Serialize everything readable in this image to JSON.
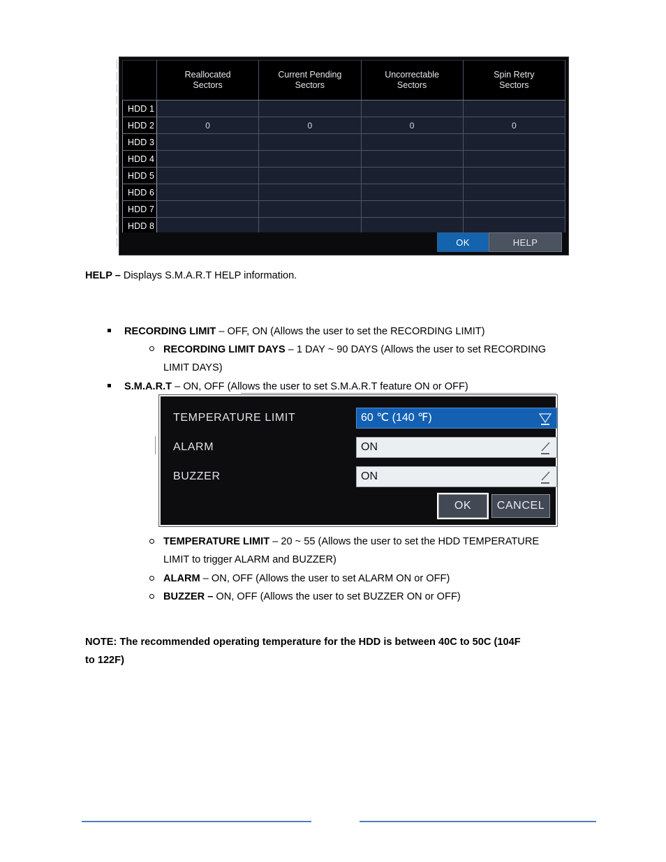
{
  "smart_table_screenshot": {
    "columns": [
      "",
      "Reallocated\nSectors",
      "Current Pending\nSectors",
      "Uncorrectable\nSectors",
      "Spin Retry\nSectors"
    ],
    "column_headers": [
      {
        "line1": "Reallocated",
        "line2": "Sectors"
      },
      {
        "line1": "Current Pending",
        "line2": "Sectors"
      },
      {
        "line1": "Uncorrectable",
        "line2": "Sectors"
      },
      {
        "line1": "Spin Retry",
        "line2": "Sectors"
      }
    ],
    "rows": [
      {
        "label": "HDD 1",
        "values": [
          "",
          "",
          "",
          ""
        ]
      },
      {
        "label": "HDD 2",
        "values": [
          "0",
          "0",
          "0",
          "0"
        ]
      },
      {
        "label": "HDD 3",
        "values": [
          "",
          "",
          "",
          ""
        ]
      },
      {
        "label": "HDD 4",
        "values": [
          "",
          "",
          "",
          ""
        ]
      },
      {
        "label": "HDD 5",
        "values": [
          "",
          "",
          "",
          ""
        ]
      },
      {
        "label": "HDD 6",
        "values": [
          "",
          "",
          "",
          ""
        ]
      },
      {
        "label": "HDD 7",
        "values": [
          "",
          "",
          "",
          ""
        ]
      },
      {
        "label": "HDD 8",
        "values": [
          "",
          "",
          "",
          ""
        ]
      }
    ],
    "buttons": {
      "ok": "OK",
      "help": "HELP"
    },
    "colors": {
      "ok_button": "#1463ad",
      "help_button": "#4c5360",
      "row_bg": "#1b2030",
      "header_bg": "#000000"
    }
  },
  "help_paragraph": {
    "bold": "HELP –",
    "text": " Displays S.M.A.R.T HELP information."
  },
  "settings_list": {
    "item1": {
      "bold": "RECORDING LIMIT",
      "text": " – OFF, ON (Allows the user to set the RECORDING LIMIT)"
    },
    "item1_sub": {
      "bold": "RECORDING LIMIT DAYS",
      "text_line1": " – 1 DAY ~ 90 DAYS (Allows the user to set RECORDING",
      "text_line2": "LIMIT DAYS)"
    },
    "item2": {
      "bold": "S.M.A.R.T",
      "text": " – ON, OFF (Allows the user to set S.M.A.R.T feature ON or OFF)"
    }
  },
  "temperature_dialog_screenshot": {
    "rows": [
      {
        "label": "TEMPERATURE LIMIT",
        "value": "60 ℃ (140 ℉)",
        "selected": true
      },
      {
        "label": "ALARM",
        "value": "ON",
        "selected": false
      },
      {
        "label": "BUZZER",
        "value": "ON",
        "selected": false
      }
    ],
    "buttons": {
      "ok": "OK",
      "cancel": "CANCEL"
    },
    "colors": {
      "selected_field": "#1461b4",
      "plain_field": "#eceff2",
      "dialog_bg": "#0d0d0f"
    }
  },
  "temperature_list": {
    "item1": {
      "bold": "TEMPERATURE LIMIT",
      "text_line1": " – 20 ~ 55 (Allows the user to set the HDD TEMPERATURE",
      "text_line2": "LIMIT to trigger ALARM and BUZZER)"
    },
    "item2": {
      "bold": "ALARM",
      "text": " – ON, OFF (Allows the user to set ALARM ON or OFF)"
    },
    "item3": {
      "bold": "BUZZER –",
      "text": " ON, OFF (Allows the user to set BUZZER ON or OFF)"
    }
  },
  "note": {
    "line1": "NOTE: The recommended operating temperature for the HDD is between 40C to 50C (104F",
    "line2": "to 122F)"
  },
  "footer": {
    "rule_color": "#4a7ebb"
  }
}
